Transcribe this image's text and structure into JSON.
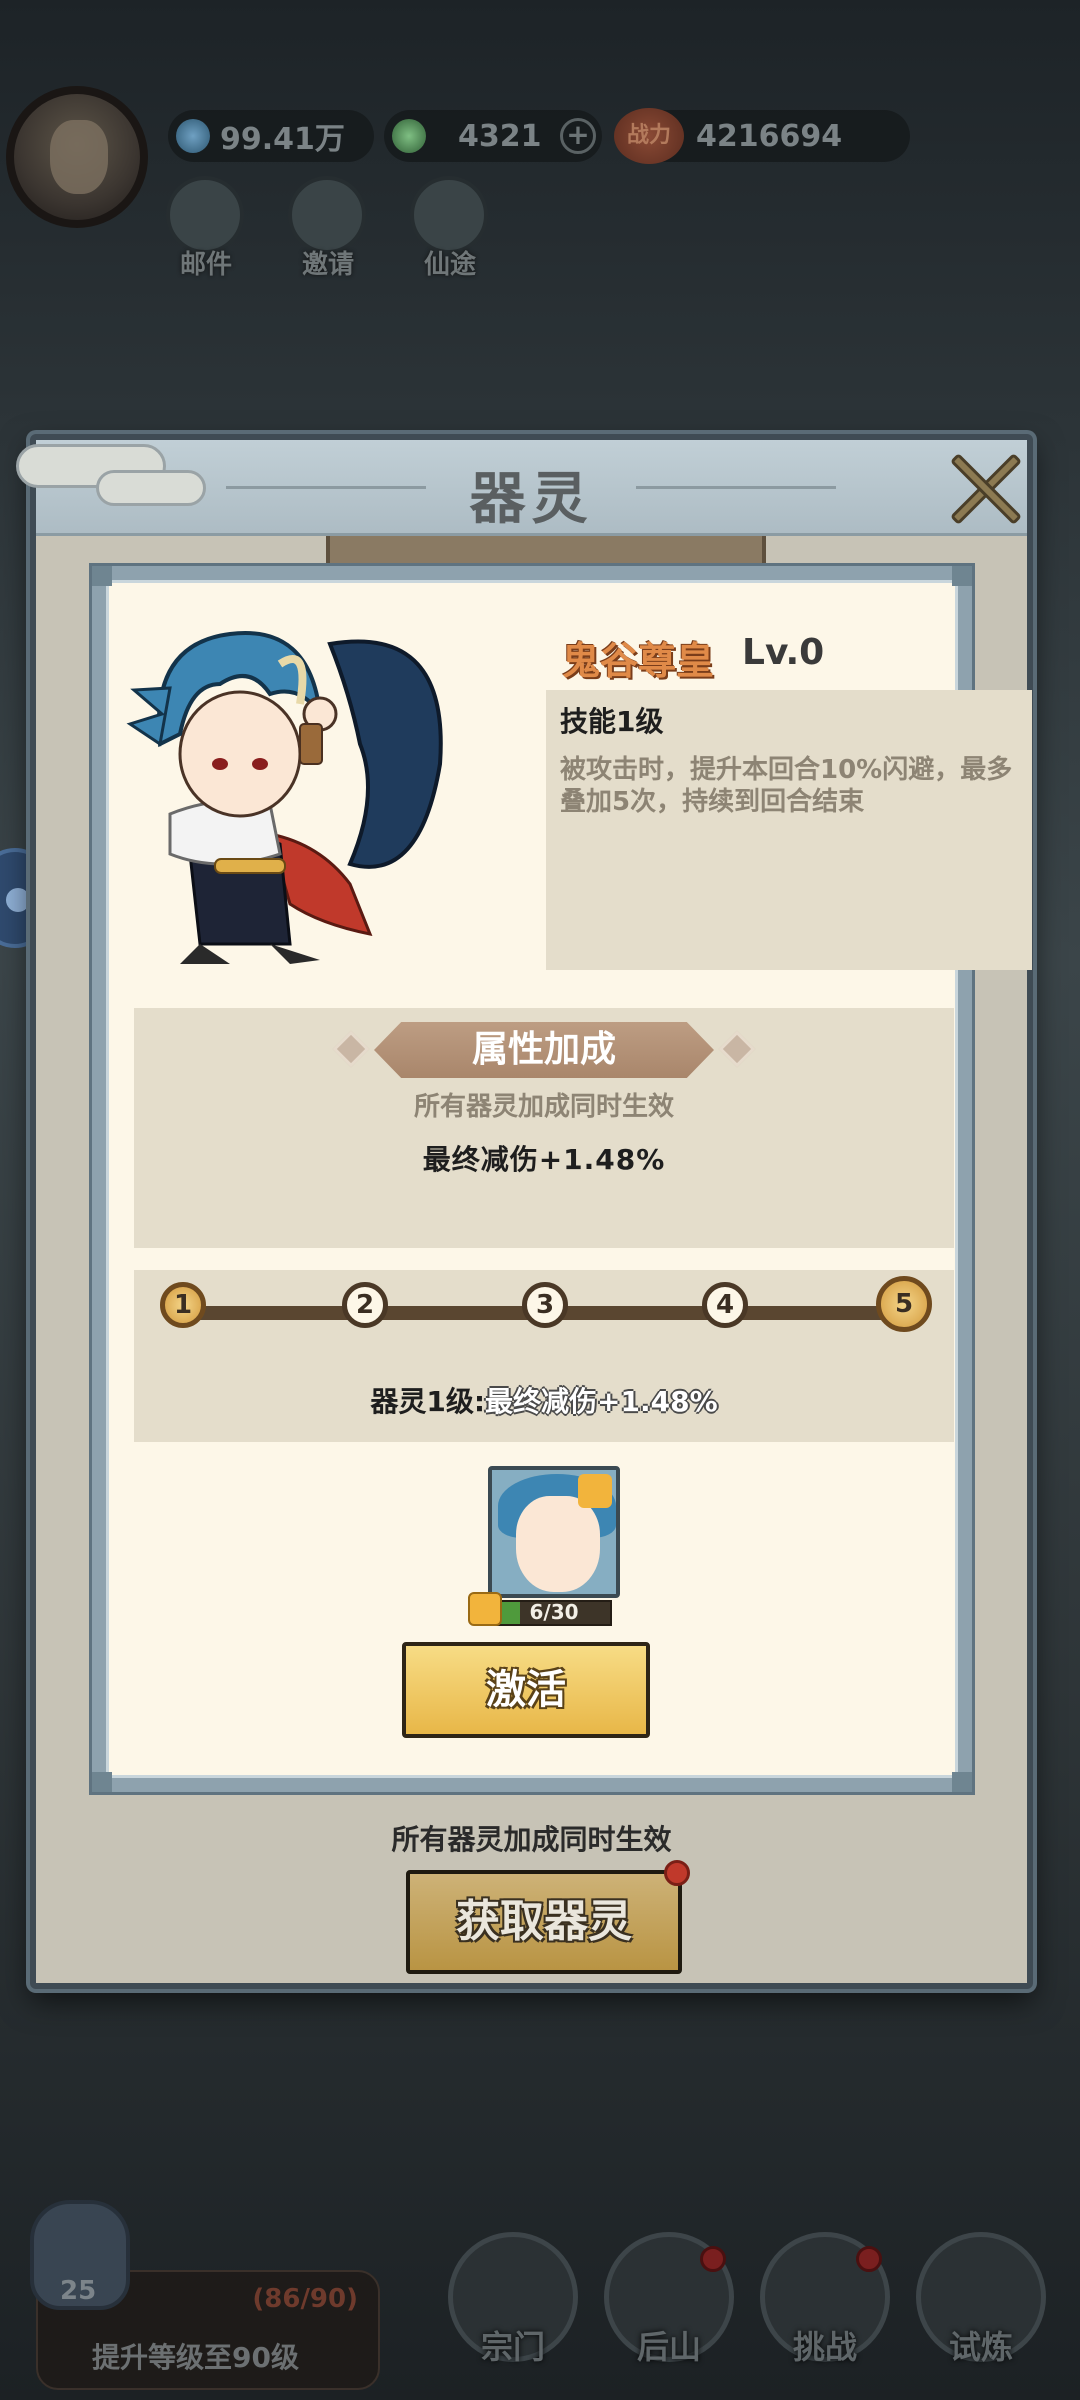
{
  "hud": {
    "coins": "99.41万",
    "jade": "4321",
    "power": "4216694",
    "power_badge": "战力",
    "buttons": [
      {
        "label": "邮件",
        "icon": "mail-icon"
      },
      {
        "label": "邀请",
        "icon": "invite-icon"
      },
      {
        "label": "仙途",
        "icon": "path-icon"
      }
    ]
  },
  "bottom": {
    "quest_level": "25",
    "quest_progress": "(86/90)",
    "quest_text": "提升等级至90级",
    "nav": [
      {
        "label": "宗门",
        "icon": "sect-icon"
      },
      {
        "label": "后山",
        "icon": "mountain-icon"
      },
      {
        "label": "挑战",
        "icon": "challenge-icon"
      },
      {
        "label": "试炼",
        "icon": "trial-icon"
      }
    ]
  },
  "modal": {
    "title": "器灵",
    "hero_name": "鬼谷尊皇",
    "hero_level": "Lv.0",
    "skill_title": "技能1级",
    "skill_desc": "被攻击时，提升本回合10%闪避，最多叠加5次，持续到回合结束",
    "attr_title": "属性加成",
    "attr_note": "所有器灵加成同时生效",
    "attr_value": "最终减伤+1.48%",
    "level_nodes": [
      "1",
      "2",
      "3",
      "4",
      "5"
    ],
    "level_text_prefix": "器灵1级:",
    "level_text_value": "最终减伤+1.48%",
    "fragment_count": "6/30",
    "fragment_progress": 0.2,
    "activate_label": "激活",
    "footer_note": "所有器灵加成同时生效",
    "get_label": "获取器灵"
  },
  "colors": {
    "hero_name": "#e08a48",
    "panel": "#fdf7e8",
    "section": "#e4ddcb",
    "button_gold": "#e8b748"
  }
}
